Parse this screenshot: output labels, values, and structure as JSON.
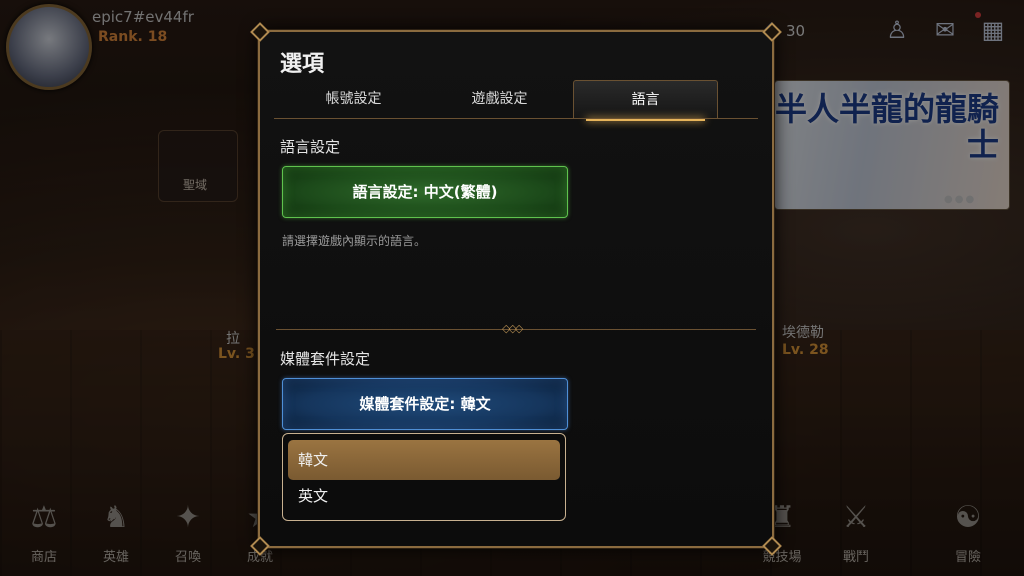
{
  "player": {
    "name": "epic7#ev44fr",
    "rank": "Rank. 18"
  },
  "currency": {
    "count": "30"
  },
  "banner": {
    "title": "半人半龍的龍騎士"
  },
  "characters": [
    {
      "name": "拉",
      "level": "Lv. 3"
    },
    {
      "name": "埃德勒",
      "level": "Lv. 28"
    }
  ],
  "sanctuary": {
    "label": "聖域"
  },
  "bottom_menu": [
    {
      "label": "商店",
      "icon": "scale-icon"
    },
    {
      "label": "英雄",
      "icon": "heroes-icon"
    },
    {
      "label": "召喚",
      "icon": "summon-icon"
    },
    {
      "label": "成就",
      "icon": "achievement-icon"
    },
    {
      "label": "競技場",
      "icon": "arena-icon"
    },
    {
      "label": "戰鬥",
      "icon": "battle-icon"
    },
    {
      "label": "冒險",
      "icon": "adventure-icon"
    }
  ],
  "options": {
    "title": "選項",
    "tabs": [
      {
        "label": "帳號設定"
      },
      {
        "label": "遊戲設定"
      },
      {
        "label": "語言",
        "active": true
      }
    ],
    "language_section": {
      "title": "語言設定",
      "button": "語言設定: 中文(繁體)",
      "description": "請選擇遊戲內顯示的語言。"
    },
    "media_section": {
      "title": "媒體套件設定",
      "button": "媒體套件設定: 韓文",
      "options": [
        {
          "label": "韓文",
          "selected": true
        },
        {
          "label": "英文",
          "selected": false
        }
      ]
    }
  },
  "colors": {
    "accent_gold": "#e6b45a",
    "green_button": "#2f6a2a",
    "blue_button": "#1f4a7a",
    "selected_option": "#9a7441",
    "rank": "#e08a3c"
  }
}
